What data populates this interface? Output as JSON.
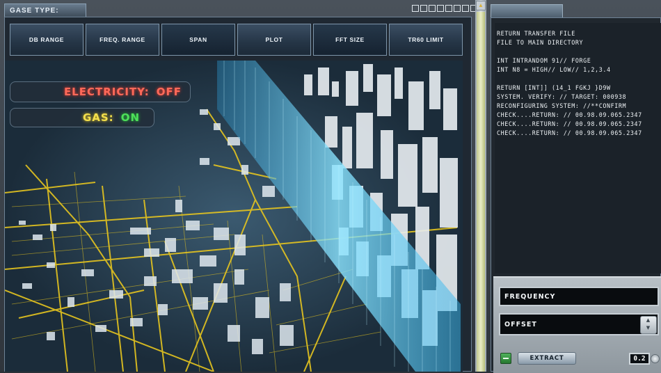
{
  "left_panel": {
    "tab_label": "GASE TYPE:"
  },
  "toolbar": [
    "dB RANGE",
    "FREQ. RANGE",
    "SPAN",
    "PLOT",
    "FFT SIZE",
    "TR60 LIMIT"
  ],
  "status": {
    "electricity_label": "ELECTRICITY:",
    "electricity_value": "OFF",
    "gas_label": "GAS:",
    "gas_value": "ON"
  },
  "console_lines": [
    "RETURN TRANSFER FILE",
    "FILE TO MAIN DIRECTORY",
    "",
    "INT intRandom 91// FORGE",
    "INT N8 = HIGH// LOW// 1,2,3.4",
    "",
    "RETURN [INT]] (14_1 FGKJ }D9w",
    "SYSTEM. VERIFY: // TARGET: 000938",
    "RECONFIGURING SYSTEM: //**CONFIRM",
    "CHECK....RETURN: // 00.98.09.065.2347",
    "CHECK....RETURN: // 00.98.09.065.2347",
    "CHECK....RETURN: // 00.98.09.065.2347"
  ],
  "controls": {
    "frequency_label": "FREQUENCY",
    "offset_label": "OFFSET",
    "extract_label": "EXTRACT",
    "value": "0.2"
  },
  "colors": {
    "electricity": "#ff6a5a",
    "gas_label": "#f3df4c",
    "gas_on": "#4ee05a",
    "grid_lines": "#e6c51f",
    "data_wall": "#5fd2ff"
  }
}
